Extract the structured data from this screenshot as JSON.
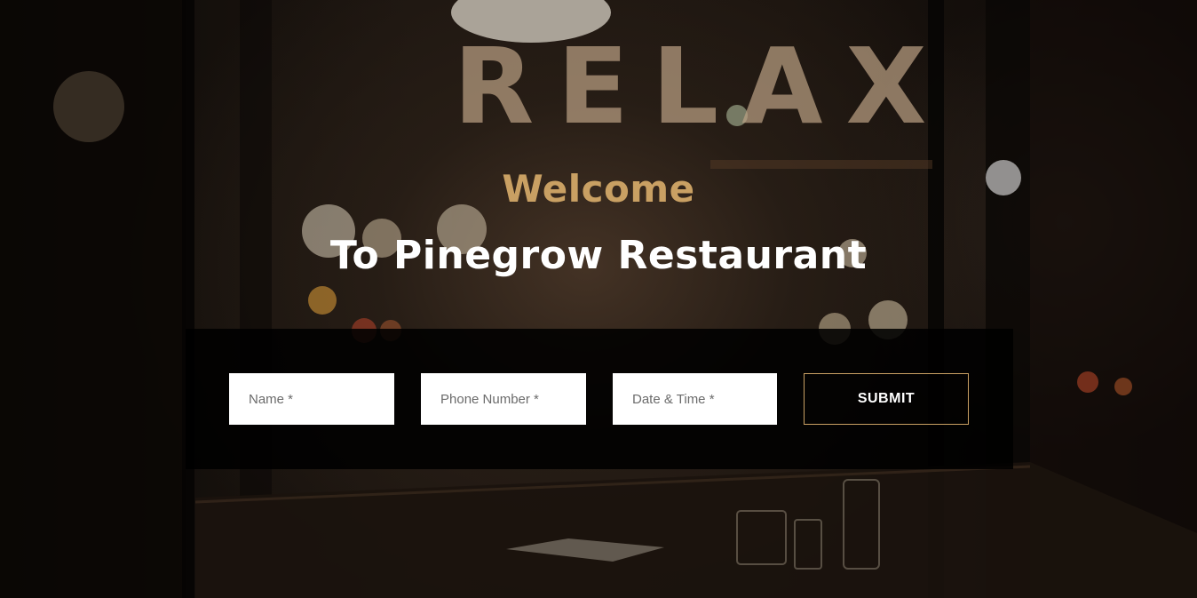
{
  "hero": {
    "sign_text": "RELAX",
    "welcome": "Welcome",
    "subtitle": "To Pinegrow Restaurant"
  },
  "form": {
    "name_placeholder": "Name *",
    "phone_placeholder": "Phone Number *",
    "datetime_placeholder": "Date & Time *",
    "submit_label": "SUBMIT"
  },
  "colors": {
    "accent": "#c9a063",
    "text": "#ffffff",
    "panel": "#000000"
  }
}
